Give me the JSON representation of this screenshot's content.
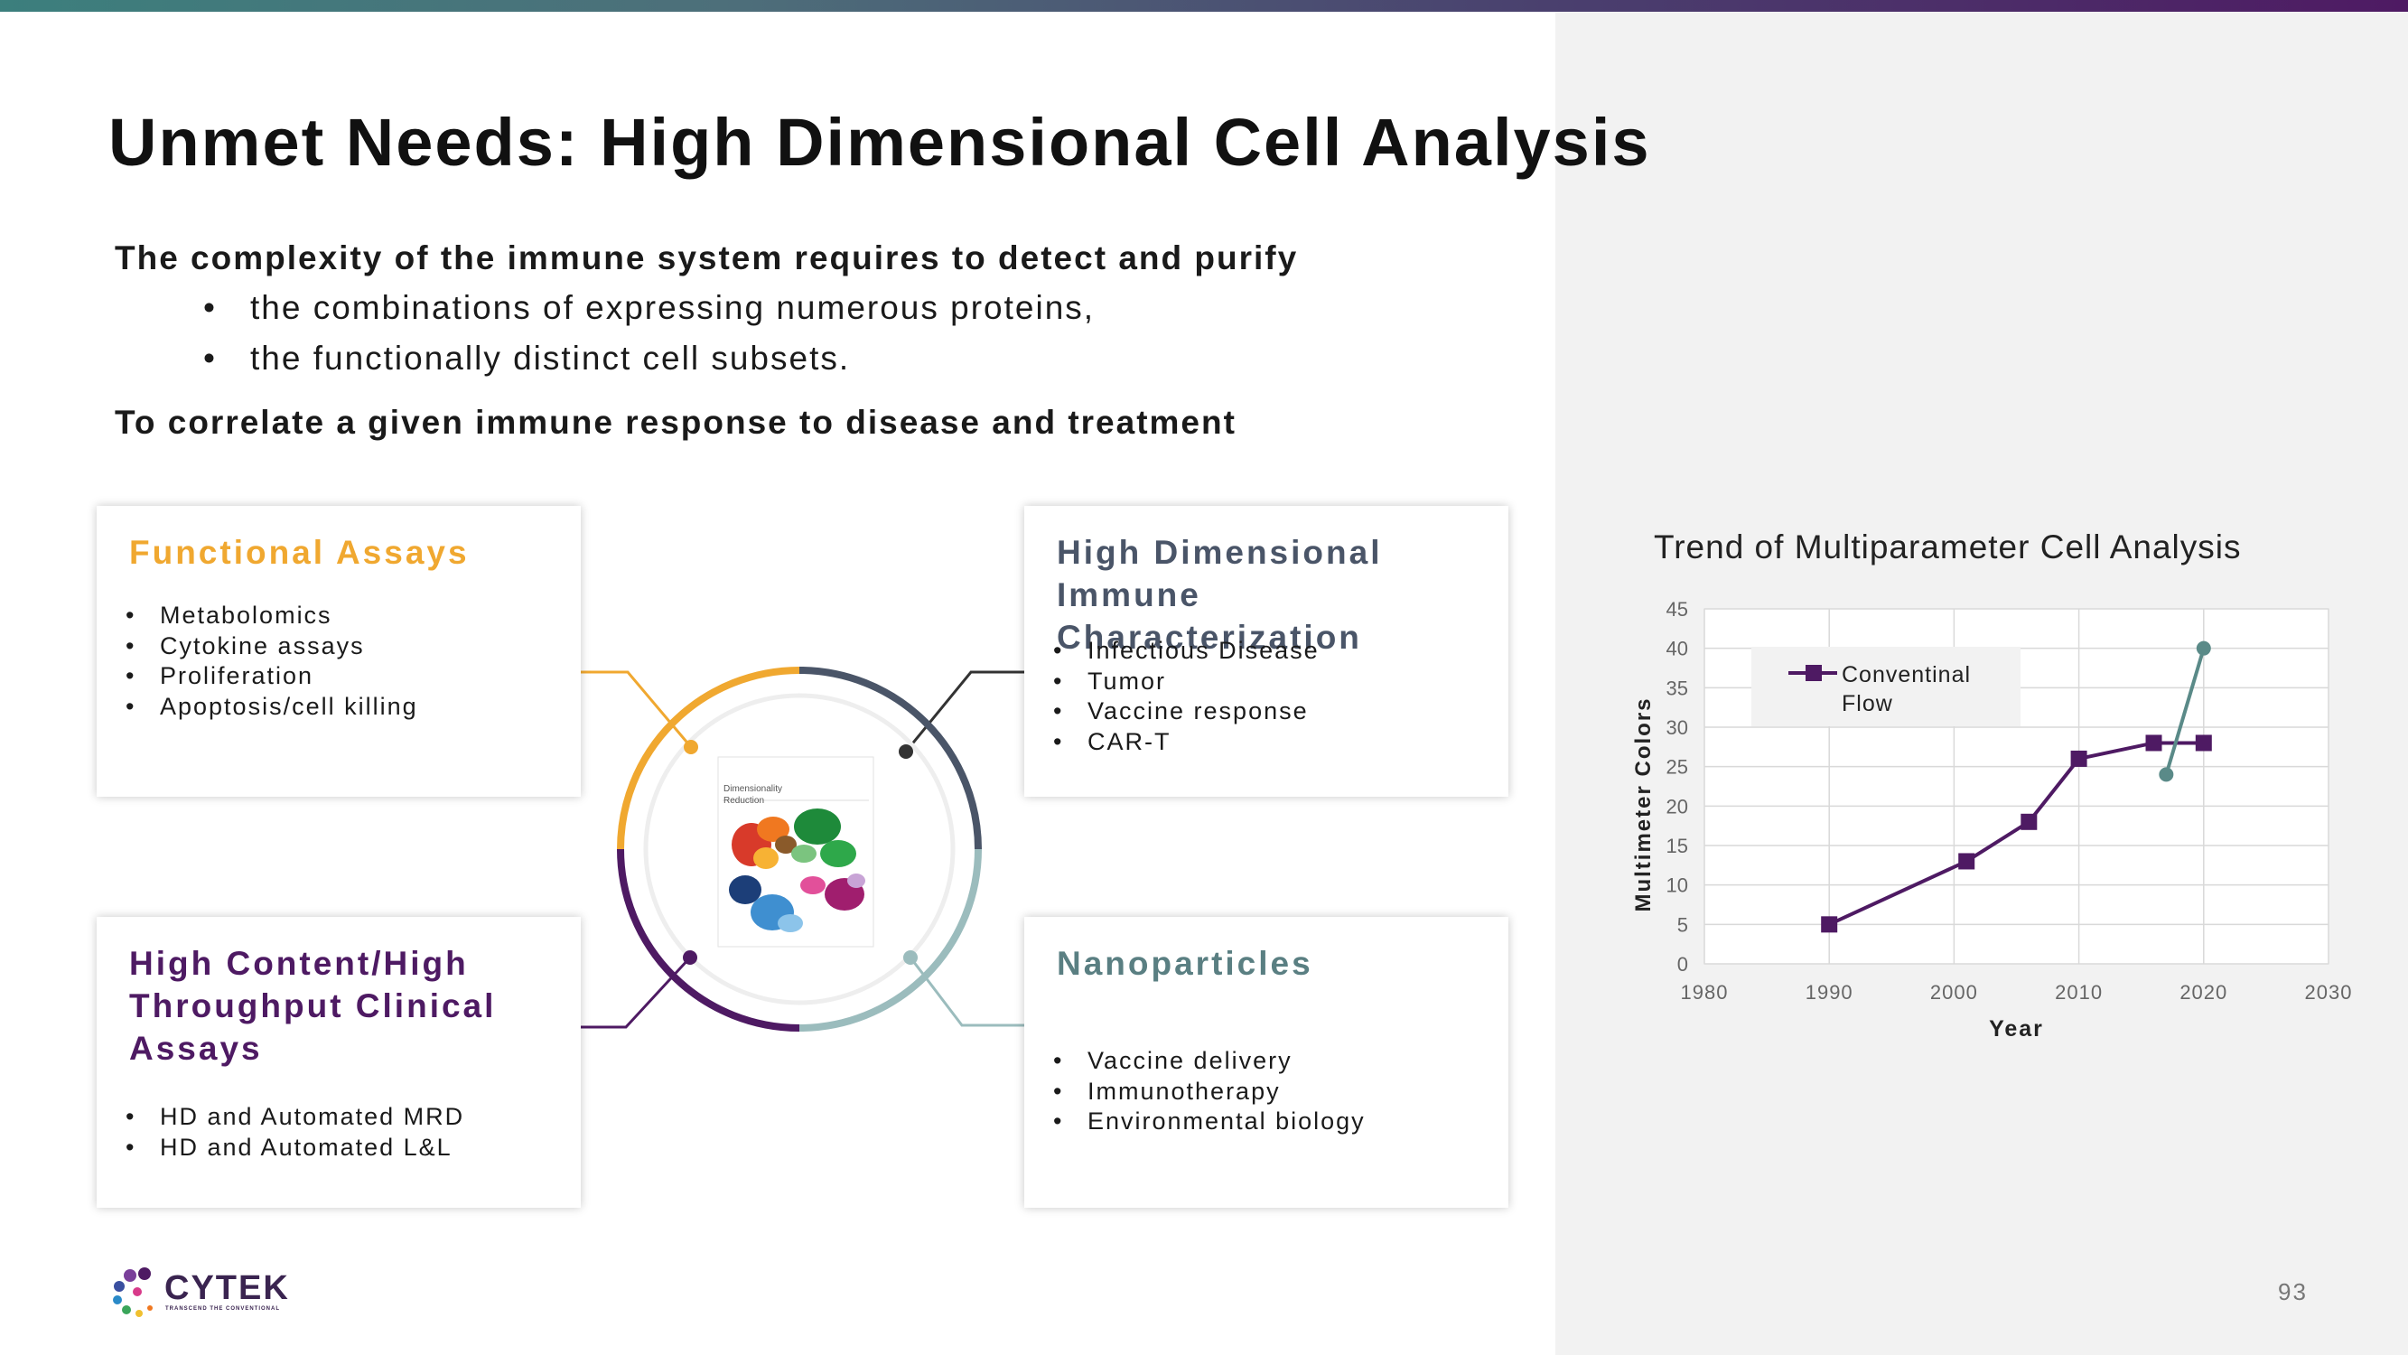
{
  "slide": {
    "title": "Unmet Needs: High Dimensional Cell Analysis",
    "intro_line1": "The complexity of the immune system requires to detect and purify",
    "intro_bullets": [
      "the combinations of expressing numerous proteins,",
      "the functionally distinct cell subsets."
    ],
    "bullet_glyph": "•",
    "intro_line2": "To correlate a given immune response to disease and treatment",
    "page_number": "93"
  },
  "cards": {
    "functional": {
      "title": "Functional Assays",
      "color": "#f0a830",
      "items": [
        "Metabolomics",
        "Cytokine assays",
        "Proliferation",
        "Apoptosis/cell killing"
      ]
    },
    "highdim": {
      "title_line1": "High Dimensional",
      "title_line2": "Immune Characterization",
      "color": "#4a5568",
      "items": [
        "Infectious Disease",
        "Tumor",
        "Vaccine response",
        "CAR-T"
      ]
    },
    "highcontent": {
      "title_line1": "High Content/High",
      "title_line2": "Throughput Clinical",
      "title_line3": "Assays",
      "color": "#4e1a63",
      "items": [
        "HD and Automated MRD",
        "HD and Automated L&L"
      ]
    },
    "nano": {
      "title": "Nanoparticles",
      "color": "#5a7f82",
      "items": [
        "Vaccine delivery",
        "Immunotherapy",
        "Environmental biology"
      ]
    }
  },
  "center_image": {
    "caption_line1": "Dimensionality",
    "caption_line2": "Reduction"
  },
  "chart_data": {
    "type": "line",
    "title": "Trend of Multiparameter Cell Analysis",
    "xlabel": "Year",
    "ylabel": "Multimeter Colors",
    "xlim": [
      1980,
      2030
    ],
    "ylim": [
      0,
      45
    ],
    "xticks": [
      1980,
      1990,
      2000,
      2010,
      2020,
      2030
    ],
    "yticks": [
      0,
      5,
      10,
      15,
      20,
      25,
      30,
      35,
      40,
      45
    ],
    "grid": true,
    "legend_position": "top-left",
    "series": [
      {
        "name": "Conventinal Flow",
        "color": "#4e1a63",
        "marker": "square",
        "x": [
          1990,
          2001,
          2006,
          2010,
          2016,
          2020
        ],
        "y": [
          5,
          13,
          18,
          26,
          28,
          28
        ]
      },
      {
        "name": "",
        "color": "#5a8a88",
        "marker": "circle",
        "x": [
          2017,
          2020
        ],
        "y": [
          24,
          40
        ]
      }
    ],
    "legend_label_line1": "Conventinal",
    "legend_label_line2": "Flow"
  },
  "logo": {
    "name": "CYTEK",
    "tagline": "TRANSCEND THE CONVENTIONAL"
  },
  "colors": {
    "orange": "#f0a830",
    "slate": "#4a5568",
    "purple": "#4e1a63",
    "teal": "#9bbcbd"
  }
}
